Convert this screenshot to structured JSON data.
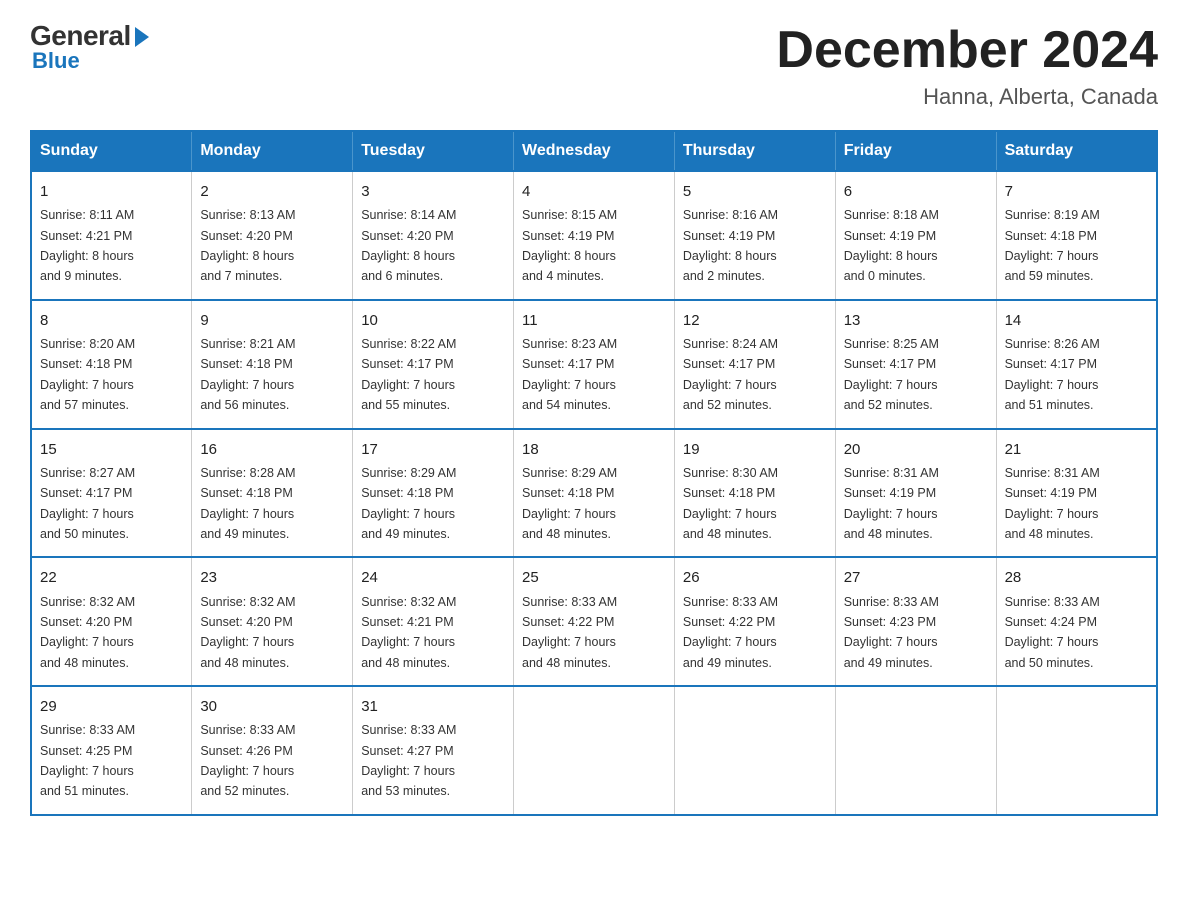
{
  "logo": {
    "general": "General",
    "blue": "Blue"
  },
  "title": "December 2024",
  "location": "Hanna, Alberta, Canada",
  "days_of_week": [
    "Sunday",
    "Monday",
    "Tuesday",
    "Wednesday",
    "Thursday",
    "Friday",
    "Saturday"
  ],
  "weeks": [
    [
      {
        "day": "1",
        "info": "Sunrise: 8:11 AM\nSunset: 4:21 PM\nDaylight: 8 hours\nand 9 minutes."
      },
      {
        "day": "2",
        "info": "Sunrise: 8:13 AM\nSunset: 4:20 PM\nDaylight: 8 hours\nand 7 minutes."
      },
      {
        "day": "3",
        "info": "Sunrise: 8:14 AM\nSunset: 4:20 PM\nDaylight: 8 hours\nand 6 minutes."
      },
      {
        "day": "4",
        "info": "Sunrise: 8:15 AM\nSunset: 4:19 PM\nDaylight: 8 hours\nand 4 minutes."
      },
      {
        "day": "5",
        "info": "Sunrise: 8:16 AM\nSunset: 4:19 PM\nDaylight: 8 hours\nand 2 minutes."
      },
      {
        "day": "6",
        "info": "Sunrise: 8:18 AM\nSunset: 4:19 PM\nDaylight: 8 hours\nand 0 minutes."
      },
      {
        "day": "7",
        "info": "Sunrise: 8:19 AM\nSunset: 4:18 PM\nDaylight: 7 hours\nand 59 minutes."
      }
    ],
    [
      {
        "day": "8",
        "info": "Sunrise: 8:20 AM\nSunset: 4:18 PM\nDaylight: 7 hours\nand 57 minutes."
      },
      {
        "day": "9",
        "info": "Sunrise: 8:21 AM\nSunset: 4:18 PM\nDaylight: 7 hours\nand 56 minutes."
      },
      {
        "day": "10",
        "info": "Sunrise: 8:22 AM\nSunset: 4:17 PM\nDaylight: 7 hours\nand 55 minutes."
      },
      {
        "day": "11",
        "info": "Sunrise: 8:23 AM\nSunset: 4:17 PM\nDaylight: 7 hours\nand 54 minutes."
      },
      {
        "day": "12",
        "info": "Sunrise: 8:24 AM\nSunset: 4:17 PM\nDaylight: 7 hours\nand 52 minutes."
      },
      {
        "day": "13",
        "info": "Sunrise: 8:25 AM\nSunset: 4:17 PM\nDaylight: 7 hours\nand 52 minutes."
      },
      {
        "day": "14",
        "info": "Sunrise: 8:26 AM\nSunset: 4:17 PM\nDaylight: 7 hours\nand 51 minutes."
      }
    ],
    [
      {
        "day": "15",
        "info": "Sunrise: 8:27 AM\nSunset: 4:17 PM\nDaylight: 7 hours\nand 50 minutes."
      },
      {
        "day": "16",
        "info": "Sunrise: 8:28 AM\nSunset: 4:18 PM\nDaylight: 7 hours\nand 49 minutes."
      },
      {
        "day": "17",
        "info": "Sunrise: 8:29 AM\nSunset: 4:18 PM\nDaylight: 7 hours\nand 49 minutes."
      },
      {
        "day": "18",
        "info": "Sunrise: 8:29 AM\nSunset: 4:18 PM\nDaylight: 7 hours\nand 48 minutes."
      },
      {
        "day": "19",
        "info": "Sunrise: 8:30 AM\nSunset: 4:18 PM\nDaylight: 7 hours\nand 48 minutes."
      },
      {
        "day": "20",
        "info": "Sunrise: 8:31 AM\nSunset: 4:19 PM\nDaylight: 7 hours\nand 48 minutes."
      },
      {
        "day": "21",
        "info": "Sunrise: 8:31 AM\nSunset: 4:19 PM\nDaylight: 7 hours\nand 48 minutes."
      }
    ],
    [
      {
        "day": "22",
        "info": "Sunrise: 8:32 AM\nSunset: 4:20 PM\nDaylight: 7 hours\nand 48 minutes."
      },
      {
        "day": "23",
        "info": "Sunrise: 8:32 AM\nSunset: 4:20 PM\nDaylight: 7 hours\nand 48 minutes."
      },
      {
        "day": "24",
        "info": "Sunrise: 8:32 AM\nSunset: 4:21 PM\nDaylight: 7 hours\nand 48 minutes."
      },
      {
        "day": "25",
        "info": "Sunrise: 8:33 AM\nSunset: 4:22 PM\nDaylight: 7 hours\nand 48 minutes."
      },
      {
        "day": "26",
        "info": "Sunrise: 8:33 AM\nSunset: 4:22 PM\nDaylight: 7 hours\nand 49 minutes."
      },
      {
        "day": "27",
        "info": "Sunrise: 8:33 AM\nSunset: 4:23 PM\nDaylight: 7 hours\nand 49 minutes."
      },
      {
        "day": "28",
        "info": "Sunrise: 8:33 AM\nSunset: 4:24 PM\nDaylight: 7 hours\nand 50 minutes."
      }
    ],
    [
      {
        "day": "29",
        "info": "Sunrise: 8:33 AM\nSunset: 4:25 PM\nDaylight: 7 hours\nand 51 minutes."
      },
      {
        "day": "30",
        "info": "Sunrise: 8:33 AM\nSunset: 4:26 PM\nDaylight: 7 hours\nand 52 minutes."
      },
      {
        "day": "31",
        "info": "Sunrise: 8:33 AM\nSunset: 4:27 PM\nDaylight: 7 hours\nand 53 minutes."
      },
      {
        "day": "",
        "info": ""
      },
      {
        "day": "",
        "info": ""
      },
      {
        "day": "",
        "info": ""
      },
      {
        "day": "",
        "info": ""
      }
    ]
  ]
}
